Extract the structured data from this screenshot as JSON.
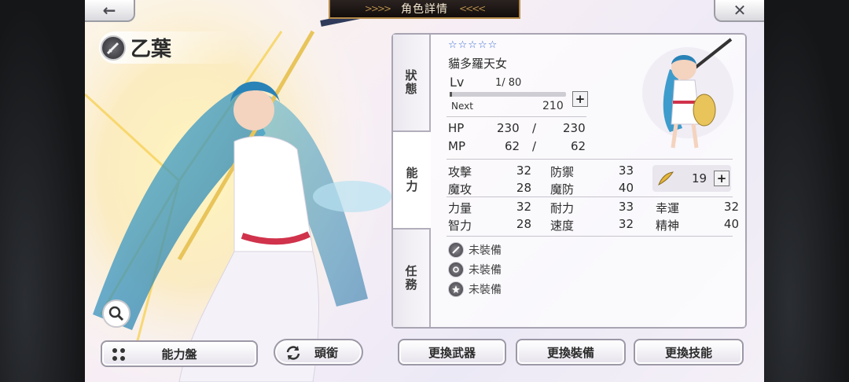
{
  "header": {
    "title": "角色詳情",
    "back_icon": "left-arrow-icon",
    "close_icon": "close-icon"
  },
  "character": {
    "name": "乙葉",
    "weapon_icon": "sword-badge-icon"
  },
  "tabs": [
    {
      "label": "狀態"
    },
    {
      "label": "能力"
    },
    {
      "label": "任務"
    }
  ],
  "profile": {
    "stars": "☆☆☆☆☆",
    "class_name": "貓多羅天女",
    "lv_label": "Lv",
    "lv_value": "1/ 80",
    "exp_progress": 0.02,
    "next_label": "Next",
    "next_value": "210"
  },
  "hp": {
    "label": "HP",
    "current": "230",
    "sep": "/",
    "max": "230"
  },
  "mp": {
    "label": "MP",
    "current": "62",
    "sep": "/",
    "max": "62"
  },
  "stats": [
    {
      "label": "攻擊",
      "value": "32"
    },
    {
      "label": "防禦",
      "value": "33"
    },
    {
      "label": "魔攻",
      "value": "28"
    },
    {
      "label": "魔防",
      "value": "40"
    },
    {
      "label": "力量",
      "value": "32"
    },
    {
      "label": "耐力",
      "value": "33"
    },
    {
      "label": "幸運",
      "value": "32"
    },
    {
      "label": "智力",
      "value": "28"
    },
    {
      "label": "速度",
      "value": "32"
    },
    {
      "label": "精神",
      "value": "40"
    }
  ],
  "points": {
    "value": "19",
    "icon": "feather-icon"
  },
  "equipment": [
    {
      "label": "未裝備",
      "icon": "weapon-slot-icon"
    },
    {
      "label": "未裝備",
      "icon": "accessory-slot-icon"
    },
    {
      "label": "未裝備",
      "icon": "skill-slot-icon"
    }
  ],
  "buttons": {
    "ability_board": "能力盤",
    "title_button": "頭銜",
    "change_weapon": "更換武器",
    "change_equipment": "更換裝備",
    "change_skill": "更換技能"
  },
  "colors": {
    "accent_blue": "#3f6fd8",
    "frame_gold": "#b58c4a",
    "panel_border": "#a8a4b2"
  }
}
